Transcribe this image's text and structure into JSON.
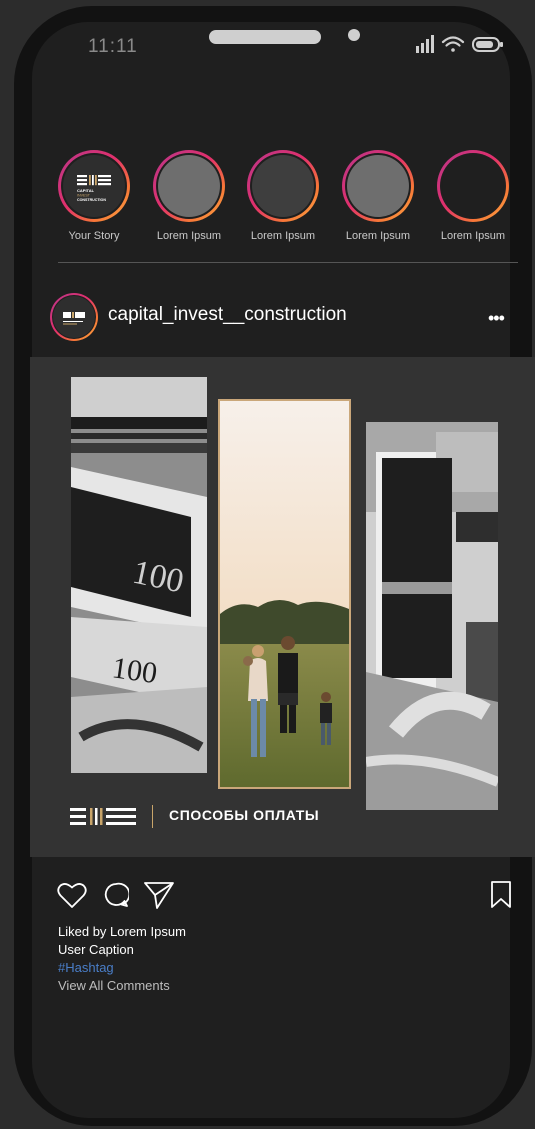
{
  "status_bar": {
    "time": "11:11",
    "icons": [
      "signal-icon",
      "wifi-icon",
      "battery-icon"
    ]
  },
  "stories": [
    {
      "label": "Your Story",
      "kind": "logo"
    },
    {
      "label": "Lorem Ipsum",
      "fill": "#6e6e6e"
    },
    {
      "label": "Lorem Ipsum",
      "fill": "#3e3e3e"
    },
    {
      "label": "Lorem Ipsum",
      "fill": "#6e6e6e"
    },
    {
      "label": "Lorem Ipsum",
      "fill": "#1f1f1f"
    }
  ],
  "logo": {
    "line1": "CAPITAL",
    "line2": "INVEST",
    "line3": "CONSTRUCTION"
  },
  "post": {
    "username": "capital_invest__construction",
    "more": "•••",
    "image_caption": "СПОСОБЫ ОПЛАТЫ",
    "liked_by": "Liked by Lorem Ipsum",
    "caption": "User Caption",
    "hashtag": "#Hashtag",
    "view_comments": "View All Comments"
  },
  "colors": {
    "background": "#2c2c2c",
    "screen": "#1f1f1f",
    "post_panel": "#333333",
    "accent_gold": "#c9a56a",
    "hashtag": "#4a7ec8",
    "story_ring_start": "#c13584",
    "story_ring_end": "#fcaf45"
  }
}
